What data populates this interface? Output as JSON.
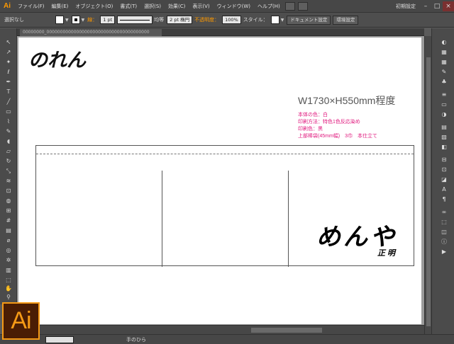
{
  "app": {
    "logo": "Ai",
    "badge": "Ai"
  },
  "menu": [
    "ファイル(F)",
    "編集(E)",
    "オブジェクト(O)",
    "書式(T)",
    "選択(S)",
    "効果(C)",
    "表示(V)",
    "ウィンドウ(W)",
    "ヘルプ(H)"
  ],
  "workspace": {
    "label": "初期設定"
  },
  "window_controls": {
    "minimize": "–",
    "restore": "□",
    "close": "×"
  },
  "control_bar": {
    "selection": "選択なし",
    "stroke_label": "線：",
    "stroke_weight": "1 pt",
    "stroke_profile": "均等",
    "brush": "2 pt 楕円",
    "opacity_label": "不透明度：",
    "opacity": "100%",
    "style_label": "スタイル：",
    "document_setup": "ドキュメント設定",
    "preferences": "環境設定"
  },
  "doc_tab": {
    "title": "00000000_00000000000000000000000000000000000000"
  },
  "status": {
    "zoom": "",
    "tool": "手のひら"
  },
  "artwork": {
    "title": "のれん",
    "dimensions": "W1730×H550mm程度",
    "spec_lines": [
      "本体の色：白",
      "印刷方法：特色1色反応染め",
      "印刷色：黒",
      "上部棒袋(45mm幅)　3巾　本仕立て"
    ],
    "brand": "めんや",
    "signature": "正明"
  },
  "colors": {
    "accent": "#ff9a00",
    "spec_text": "#e0167c",
    "ui_dark": "#474747"
  }
}
